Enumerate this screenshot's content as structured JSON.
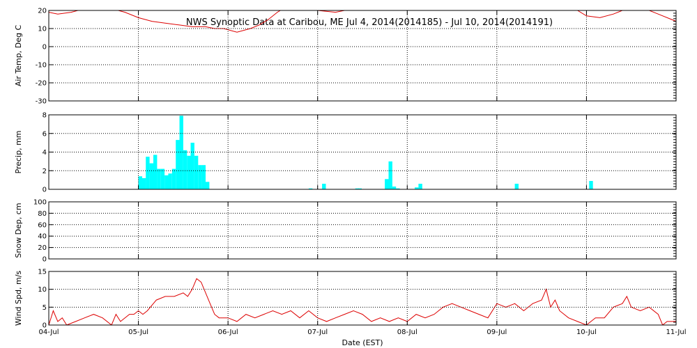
{
  "chart_data": {
    "title": "NWS Synoptic Data at Caribou, ME   Jul  4, 2014(2014185) - Jul 10, 2014(2014191)",
    "xlabel": "Date (EST)",
    "x_ticks": [
      "04-Jul",
      "05-Jul",
      "06-Jul",
      "07-Jul",
      "08-Jul",
      "09-Jul",
      "10-Jul",
      "11-Jul"
    ],
    "x_range_days": [
      0,
      7
    ],
    "grid": true,
    "panels": [
      {
        "id": "air-temp",
        "type": "line",
        "ylabel": "Air Temp, Deg C",
        "ylim": [
          -30,
          20
        ],
        "yticks": [
          -30,
          -20,
          -10,
          0,
          10,
          20
        ],
        "color": "#dd0000",
        "series": [
          {
            "x": [
              0,
              0.1,
              0.25,
              0.4,
              0.55,
              0.7,
              0.85,
              1.0,
              1.15,
              1.3,
              1.45,
              1.6,
              1.75,
              1.85,
              1.95,
              2.1,
              2.25,
              2.35,
              2.45,
              2.55,
              2.65,
              2.75,
              2.85,
              3.0,
              3.2,
              3.4,
              3.6,
              3.8,
              4.0,
              4.2,
              4.4,
              4.6,
              4.8,
              5.0,
              5.2,
              5.4,
              5.6,
              5.8,
              5.9,
              6.0,
              6.15,
              6.3,
              6.45,
              6.6,
              6.8,
              7.0
            ],
            "y": [
              19,
              18,
              19,
              21,
              22,
              21,
              19,
              16,
              14,
              13,
              12,
              11,
              11,
              10,
              10,
              8,
              10,
              12,
              15,
              19,
              22,
              24,
              22,
              20,
              19,
              21,
              22,
              21,
              20,
              22,
              23,
              21,
              20,
              21,
              22,
              21,
              21,
              22,
              20,
              17,
              16,
              18,
              21,
              22,
              18,
              14
            ]
          }
        ]
      },
      {
        "id": "precip",
        "type": "bar",
        "ylabel": "Precip, mm",
        "ylim": [
          0,
          8
        ],
        "yticks": [
          0,
          2,
          4,
          6,
          8
        ],
        "color": "#00ffff",
        "bar_width_days": 0.04167,
        "series": [
          {
            "x": [
              1.0,
              1.042,
              1.083,
              1.125,
              1.167,
              1.208,
              1.25,
              1.292,
              1.333,
              1.375,
              1.417,
              1.458,
              1.5,
              1.542,
              1.583,
              1.625,
              1.667,
              1.708,
              1.75,
              1.792,
              2.9,
              3.05,
              3.42,
              3.45,
              3.75,
              3.792,
              3.833,
              3.875,
              3.917,
              4.083,
              4.125,
              5.2,
              6.03
            ],
            "y": [
              1.4,
              1.2,
              3.5,
              2.8,
              3.7,
              2.2,
              2.2,
              1.5,
              1.7,
              2.2,
              5.3,
              7.9,
              4.2,
              3.6,
              5.0,
              3.6,
              2.6,
              2.6,
              0.8,
              0.0,
              0.1,
              0.6,
              0.1,
              0.1,
              1.1,
              3.0,
              0.3,
              0.1,
              0.0,
              0.2,
              0.6,
              0.6,
              0.9
            ]
          }
        ]
      },
      {
        "id": "snow-depth",
        "type": "line",
        "ylabel": "Snow Dep, cm",
        "ylim": [
          0,
          100
        ],
        "yticks": [
          0,
          20,
          40,
          60,
          80,
          100
        ],
        "color": "#dd0000",
        "series": []
      },
      {
        "id": "wind-speed",
        "type": "line",
        "ylabel": "Wind Spd, m/s",
        "ylim": [
          0,
          15
        ],
        "yticks": [
          0,
          5,
          10,
          15
        ],
        "color": "#dd0000",
        "series": [
          {
            "x": [
              0,
              0.05,
              0.1,
              0.15,
              0.2,
              0.3,
              0.4,
              0.5,
              0.6,
              0.7,
              0.75,
              0.8,
              0.9,
              0.95,
              1.0,
              1.05,
              1.1,
              1.2,
              1.3,
              1.4,
              1.5,
              1.55,
              1.6,
              1.65,
              1.7,
              1.75,
              1.8,
              1.85,
              1.9,
              2.0,
              2.1,
              2.2,
              2.3,
              2.4,
              2.5,
              2.6,
              2.7,
              2.8,
              2.9,
              3.0,
              3.1,
              3.2,
              3.3,
              3.4,
              3.5,
              3.6,
              3.7,
              3.8,
              3.9,
              4.0,
              4.1,
              4.2,
              4.3,
              4.4,
              4.5,
              4.6,
              4.7,
              4.8,
              4.9,
              5.0,
              5.1,
              5.2,
              5.3,
              5.4,
              5.5,
              5.55,
              5.6,
              5.65,
              5.7,
              5.8,
              5.9,
              6.0,
              6.1,
              6.2,
              6.3,
              6.4,
              6.45,
              6.5,
              6.6,
              6.7,
              6.8,
              6.85,
              6.9,
              7.0
            ],
            "y": [
              0,
              4,
              1,
              2,
              0,
              1,
              2,
              3,
              2,
              0,
              3,
              1,
              3,
              3,
              4,
              3,
              4,
              7,
              8,
              8,
              9,
              8,
              10,
              13,
              12,
              9,
              6,
              3,
              2,
              2,
              1,
              3,
              2,
              3,
              4,
              3,
              4,
              2,
              4,
              2,
              1,
              2,
              3,
              4,
              3,
              1,
              2,
              1,
              2,
              1,
              3,
              2,
              3,
              5,
              6,
              5,
              4,
              3,
              2,
              6,
              5,
              6,
              4,
              6,
              7,
              10,
              5,
              7,
              4,
              2,
              1,
              0,
              2,
              2,
              5,
              6,
              8,
              5,
              4,
              5,
              3,
              0,
              1,
              1
            ]
          }
        ]
      }
    ]
  }
}
